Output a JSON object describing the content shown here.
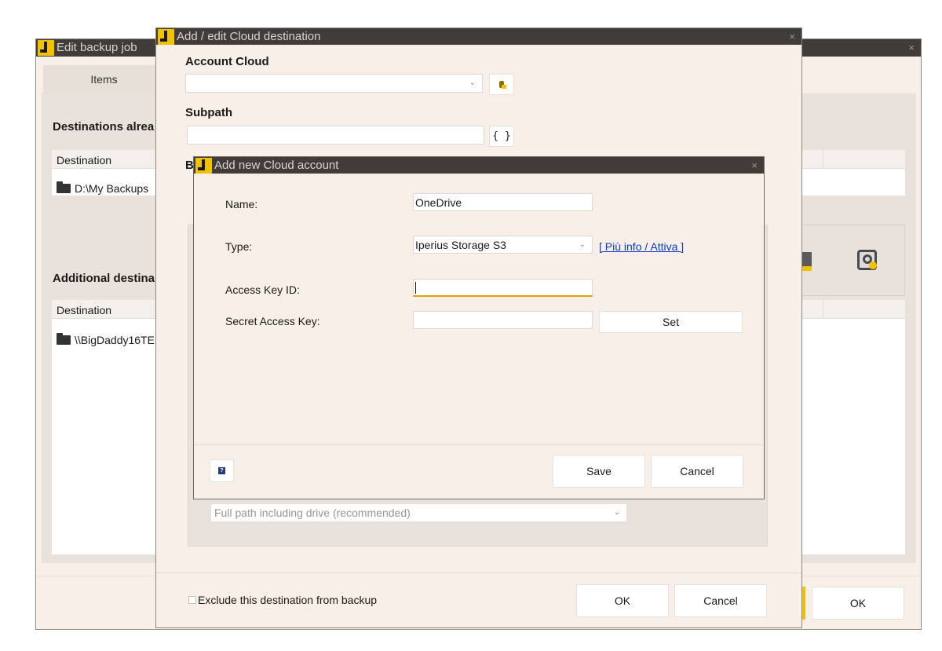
{
  "outer_window": {
    "title": "Edit backup job",
    "tab_items": "Items",
    "destinations_already_heading": "Destinations alrea",
    "column_destination": "Destination",
    "row_destination_1": "D:\\My Backups",
    "additional_heading": "Additional destina",
    "column_destination_2": "Destination",
    "row_additional_1": "\\\\BigDaddy16TE",
    "ok_label": "OK",
    "close_glyph": "×"
  },
  "cloud_dest_window": {
    "title": "Add / edit Cloud destination",
    "account_cloud_label": "Account Cloud",
    "account_cloud_value": "",
    "subpath_label": "Subpath",
    "subpath_value": "",
    "braces_label": "{ }",
    "b_label": "B",
    "path_mode_value": "Full path including drive (recommended)",
    "exclude_label": "Exclude this destination from backup",
    "ok_label": "OK",
    "cancel_label": "Cancel",
    "close_glyph": "×"
  },
  "new_account_dialog": {
    "title": "Add new Cloud account",
    "name_label": "Name:",
    "name_value": "OneDrive",
    "type_label": "Type:",
    "type_value": "Iperius Storage S3",
    "more_info_link": "[ Più info / Attiva ]",
    "access_key_label": "Access Key ID:",
    "access_key_value": "",
    "secret_key_label": "Secret Access Key:",
    "secret_key_value": "",
    "set_label": "Set",
    "save_label": "Save",
    "cancel_label": "Cancel",
    "close_glyph": "×"
  },
  "colors": {
    "window_bg": "#f7efe8",
    "title_bar": "#3f3c39",
    "logo_yellow": "#f2c200",
    "link": "#0a3ccc",
    "focus_border": "#e0a100"
  }
}
